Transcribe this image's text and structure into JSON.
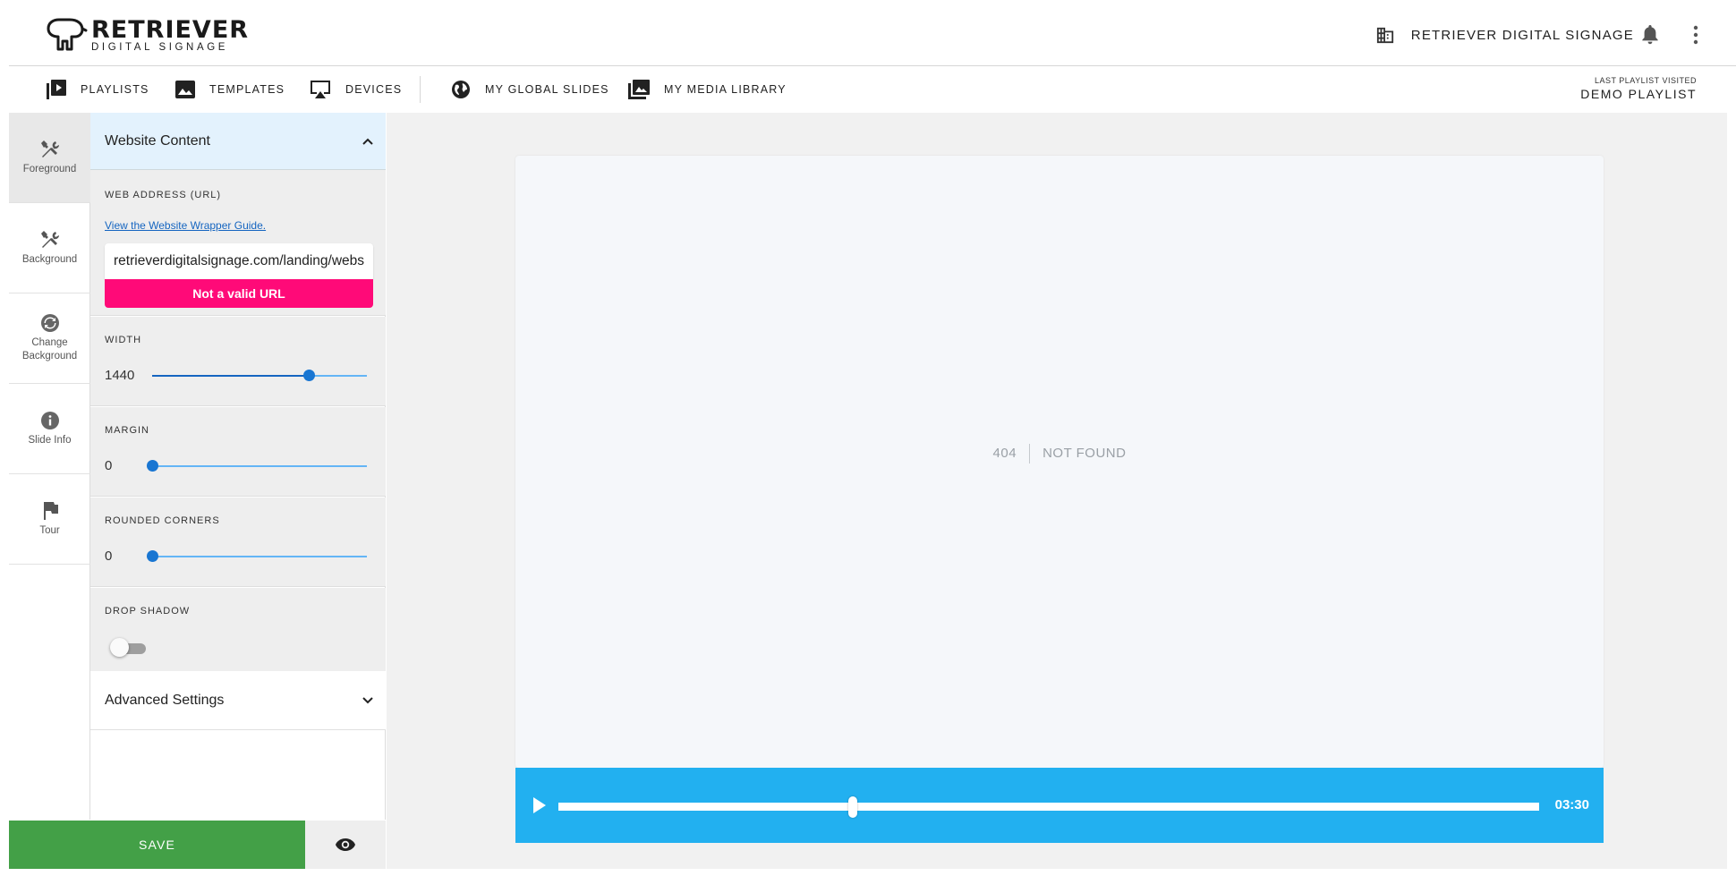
{
  "brand": {
    "name": "RETRIEVER",
    "tagline": "DIGITAL SIGNAGE"
  },
  "header": {
    "organization": "RETRIEVER DIGITAL SIGNAGE"
  },
  "nav": {
    "items": [
      {
        "label": "PLAYLISTS",
        "icon": "playlist-icon"
      },
      {
        "label": "TEMPLATES",
        "icon": "image-icon"
      },
      {
        "label": "DEVICES",
        "icon": "cast-icon"
      },
      {
        "label": "MY GLOBAL SLIDES",
        "icon": "globe-icon"
      },
      {
        "label": "MY MEDIA LIBRARY",
        "icon": "photo-library-icon"
      }
    ],
    "last_visited_label": "LAST PLAYLIST VISITED",
    "last_visited_value": "DEMO PLAYLIST"
  },
  "rail": {
    "items": [
      {
        "label": "Foreground",
        "icon": "tools-icon",
        "active": true
      },
      {
        "label": "Background",
        "icon": "tools-icon",
        "active": false
      },
      {
        "label": "Change Background",
        "icon": "refresh-icon",
        "active": false
      },
      {
        "label": "Slide Info",
        "icon": "info-icon",
        "active": false
      },
      {
        "label": "Tour",
        "icon": "flag-icon",
        "active": false
      }
    ]
  },
  "panel": {
    "website_content_title": "Website Content",
    "web_address_label": "WEB ADDRESS (URL)",
    "guide_link": "View the Website Wrapper Guide.",
    "url_value": "retrieverdigitalsignage.com/landing/website-wrapper",
    "url_error": "Not a valid URL",
    "width": {
      "label": "WIDTH",
      "value": "1440",
      "position": 0.73
    },
    "margin": {
      "label": "MARGIN",
      "value": "0",
      "position": 0.0
    },
    "rounded_corners": {
      "label": "ROUNDED CORNERS",
      "value": "0",
      "position": 0.0
    },
    "drop_shadow": {
      "label": "DROP SHADOW",
      "enabled": false
    },
    "advanced_settings_title": "Advanced Settings"
  },
  "actions": {
    "save_label": "SAVE"
  },
  "preview": {
    "error_code": "404",
    "error_message": "NOT FOUND",
    "duration": "03:30",
    "progress": 0.3
  },
  "colors": {
    "accent_blue": "#22b0f0",
    "save_green": "#43a047",
    "error_pink": "#ff0a78",
    "header_accordion": "#e3f2fd"
  }
}
